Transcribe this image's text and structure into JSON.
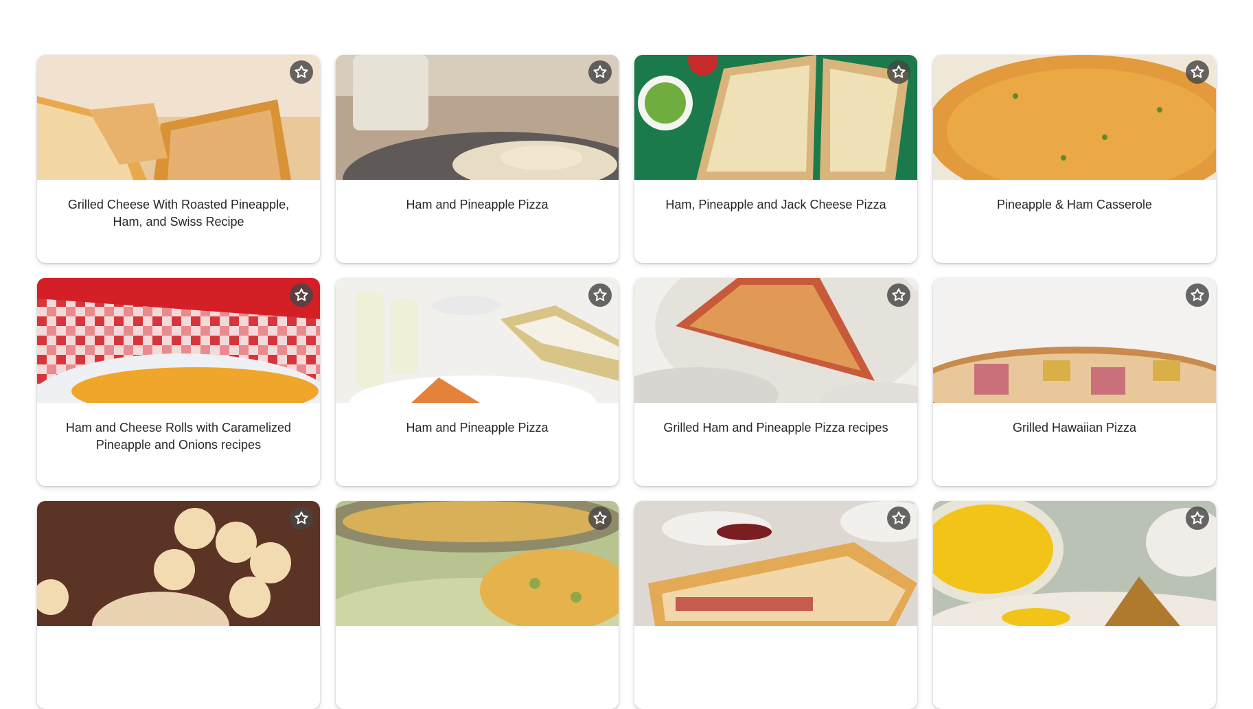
{
  "recipes": [
    {
      "title": "Grilled Cheese With Roasted Pineapple, Ham, and Swiss Recipe"
    },
    {
      "title": "Ham and Pineapple Pizza"
    },
    {
      "title": "Ham, Pineapple and Jack Cheese Pizza"
    },
    {
      "title": "Pineapple & Ham Casserole"
    },
    {
      "title": "Ham and Cheese Rolls with Caramelized Pineapple and Onions recipes"
    },
    {
      "title": "Ham and Pineapple Pizza"
    },
    {
      "title": "Grilled Ham and Pineapple Pizza recipes"
    },
    {
      "title": "Grilled Hawaiian Pizza"
    },
    {
      "title": ""
    },
    {
      "title": ""
    },
    {
      "title": ""
    },
    {
      "title": ""
    }
  ],
  "icons": {
    "favorite": "star-outline-icon"
  },
  "colors": {
    "favorite_bg": "#464646",
    "text": "#262626"
  }
}
